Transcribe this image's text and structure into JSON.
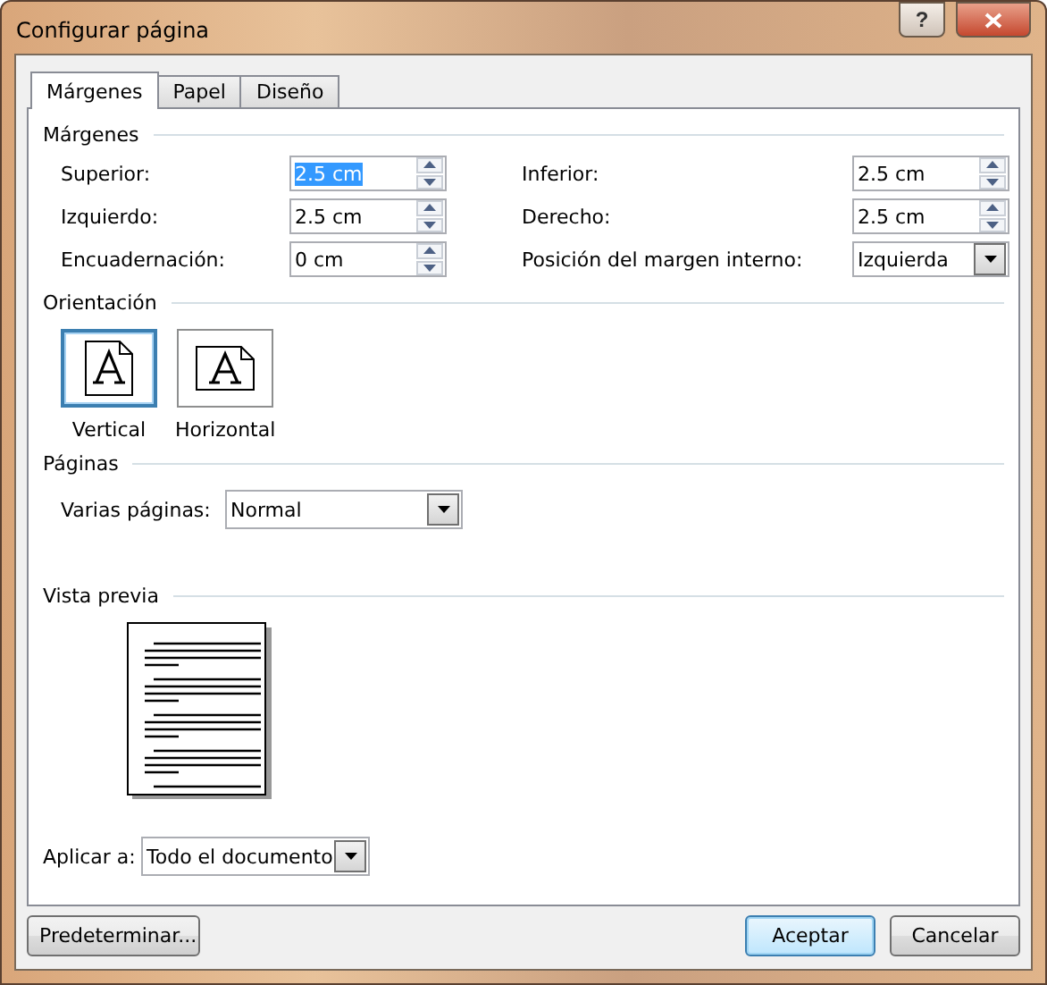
{
  "window": {
    "title": "Configurar página",
    "help_button": "?"
  },
  "tabs": [
    {
      "label": "Márgenes",
      "selected": true
    },
    {
      "label": "Papel",
      "selected": false
    },
    {
      "label": "Diseño",
      "selected": false
    }
  ],
  "margins": {
    "heading": "Márgenes",
    "fields": [
      {
        "label": "Superior:",
        "value": "2.5 cm",
        "kind": "spin",
        "text_selected": true
      },
      {
        "label": "Inferior:",
        "value": "2.5 cm",
        "kind": "spin",
        "text_selected": false
      },
      {
        "label": "Izquierdo:",
        "value": "2.5 cm",
        "kind": "spin",
        "text_selected": false
      },
      {
        "label": "Derecho:",
        "value": "2.5 cm",
        "kind": "spin",
        "text_selected": false
      },
      {
        "label": "Encuadernación:",
        "value": "0 cm",
        "kind": "spin",
        "text_selected": false
      },
      {
        "label": "Posición del margen interno:",
        "value": "Izquierda",
        "kind": "dropdown",
        "text_selected": false
      }
    ]
  },
  "orientation": {
    "heading": "Orientación",
    "options": [
      {
        "label": "Vertical",
        "kind": "portrait",
        "selected": true
      },
      {
        "label": "Horizontal",
        "kind": "landscape",
        "selected": false
      }
    ]
  },
  "pages": {
    "heading": "Páginas",
    "label": "Varias páginas:",
    "value": "Normal"
  },
  "preview": {
    "heading": "Vista previa",
    "apply_label": "Aplicar a:",
    "apply_value": "Todo el documento"
  },
  "buttons": [
    {
      "label": "Predeterminar...",
      "kind": "left",
      "default": false
    },
    {
      "label": "Aceptar",
      "kind": "right",
      "default": true
    },
    {
      "label": "Cancelar",
      "kind": "right",
      "default": false
    }
  ]
}
